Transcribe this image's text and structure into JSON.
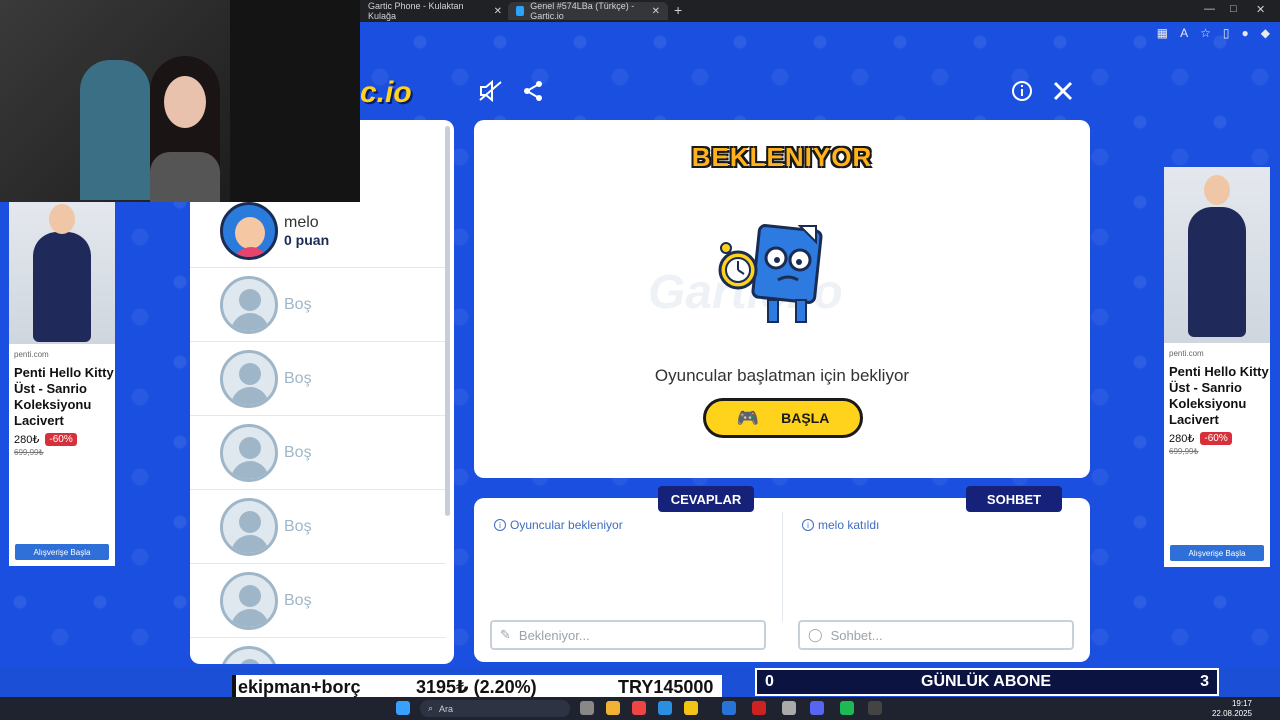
{
  "browser": {
    "tabs": [
      {
        "title": "Gartic Phone - Kulaktan Kulağa"
      },
      {
        "title": "Genel #574LBa (Türkçe) - Gartic.io"
      }
    ],
    "new_tab": "+"
  },
  "game": {
    "logo": "c.io",
    "title": "BEKLENIYOR",
    "watermark": "Gartic.io",
    "waiting_text": "Oyuncular başlatman için bekliyor",
    "start_label": "BAŞLA",
    "players": [
      {
        "name": "melo",
        "score": "0 puan",
        "empty": false
      },
      {
        "name": "Boş",
        "empty": true
      },
      {
        "name": "Boş",
        "empty": true
      },
      {
        "name": "Boş",
        "empty": true
      },
      {
        "name": "Boş",
        "empty": true
      },
      {
        "name": "Boş",
        "empty": true
      }
    ],
    "answers": {
      "label": "CEVAPLAR",
      "message": "Oyuncular bekleniyor",
      "placeholder": "Bekleniyor..."
    },
    "chat": {
      "label": "SOHBET",
      "message": "melo katıldı",
      "placeholder": "Sohbet..."
    }
  },
  "ads": {
    "left": {
      "source": "penti.com",
      "title": "Penti Hello Kitty Üst - Sanrio Koleksiyonu Lacivert",
      "price": "280₺",
      "discount": "-60%",
      "old_price": "699,99₺",
      "shop": "Alışverişe Başla"
    },
    "right": {
      "source": "penti.com",
      "title": "Penti Hello Kitty Üst - Sanrio Koleksiyonu Lacivert",
      "price": "280₺",
      "discount": "-60%",
      "old_price": "699,99₺",
      "shop": "Alışverişe Başla"
    }
  },
  "overlay": {
    "ticker": {
      "label": "ekipman+borç",
      "amount": "3195₺ (2.20%)",
      "goal": "TRY145000"
    },
    "subs": {
      "left": "0",
      "label": "GÜNLÜK ABONE",
      "right": "3"
    }
  },
  "taskbar": {
    "search": "Ara",
    "time": "19:17",
    "date": "22.08.2025"
  },
  "colors": {
    "background": "#1b4fe0",
    "accent_yellow": "#ffd21c",
    "label_navy": "#16227a"
  }
}
